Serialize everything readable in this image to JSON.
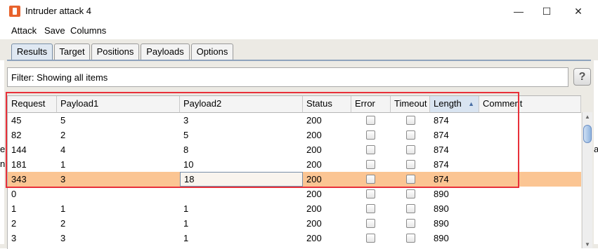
{
  "window": {
    "title": "Intruder attack 4",
    "minimize": "—",
    "maximize": "☐",
    "close": "✕"
  },
  "menu": [
    "Attack",
    "Save",
    "Columns"
  ],
  "tabs": [
    "Results",
    "Target",
    "Positions",
    "Payloads",
    "Options"
  ],
  "filter": {
    "text": "Filter: Showing all items",
    "help": "?"
  },
  "columns": [
    "Request",
    "Payload1",
    "Payload2",
    "Status",
    "Error",
    "Timeout",
    "Length",
    "Comment"
  ],
  "rows": [
    {
      "request": "45",
      "p1": "5",
      "p2": "3",
      "status": "200",
      "length": "874"
    },
    {
      "request": "82",
      "p1": "2",
      "p2": "5",
      "status": "200",
      "length": "874"
    },
    {
      "request": "144",
      "p1": "4",
      "p2": "8",
      "status": "200",
      "length": "874"
    },
    {
      "request": "181",
      "p1": "1",
      "p2": "10",
      "status": "200",
      "length": "874"
    },
    {
      "request": "343",
      "p1": "3",
      "p2": "18",
      "status": "200",
      "length": "874",
      "selected": true
    },
    {
      "request": "0",
      "p1": "",
      "p2": "",
      "status": "200",
      "length": "890"
    },
    {
      "request": "1",
      "p1": "1",
      "p2": "1",
      "status": "200",
      "length": "890"
    },
    {
      "request": "2",
      "p1": "2",
      "p2": "1",
      "status": "200",
      "length": "890"
    },
    {
      "request": "3",
      "p1": "3",
      "p2": "1",
      "status": "200",
      "length": "890"
    }
  ],
  "background_edge": {
    "left": [
      "e",
      "n"
    ],
    "right": [
      "a"
    ]
  },
  "colors": {
    "selected_row": "#fbc593",
    "highlight_box": "#e8303a",
    "accent": "#e8622c"
  }
}
